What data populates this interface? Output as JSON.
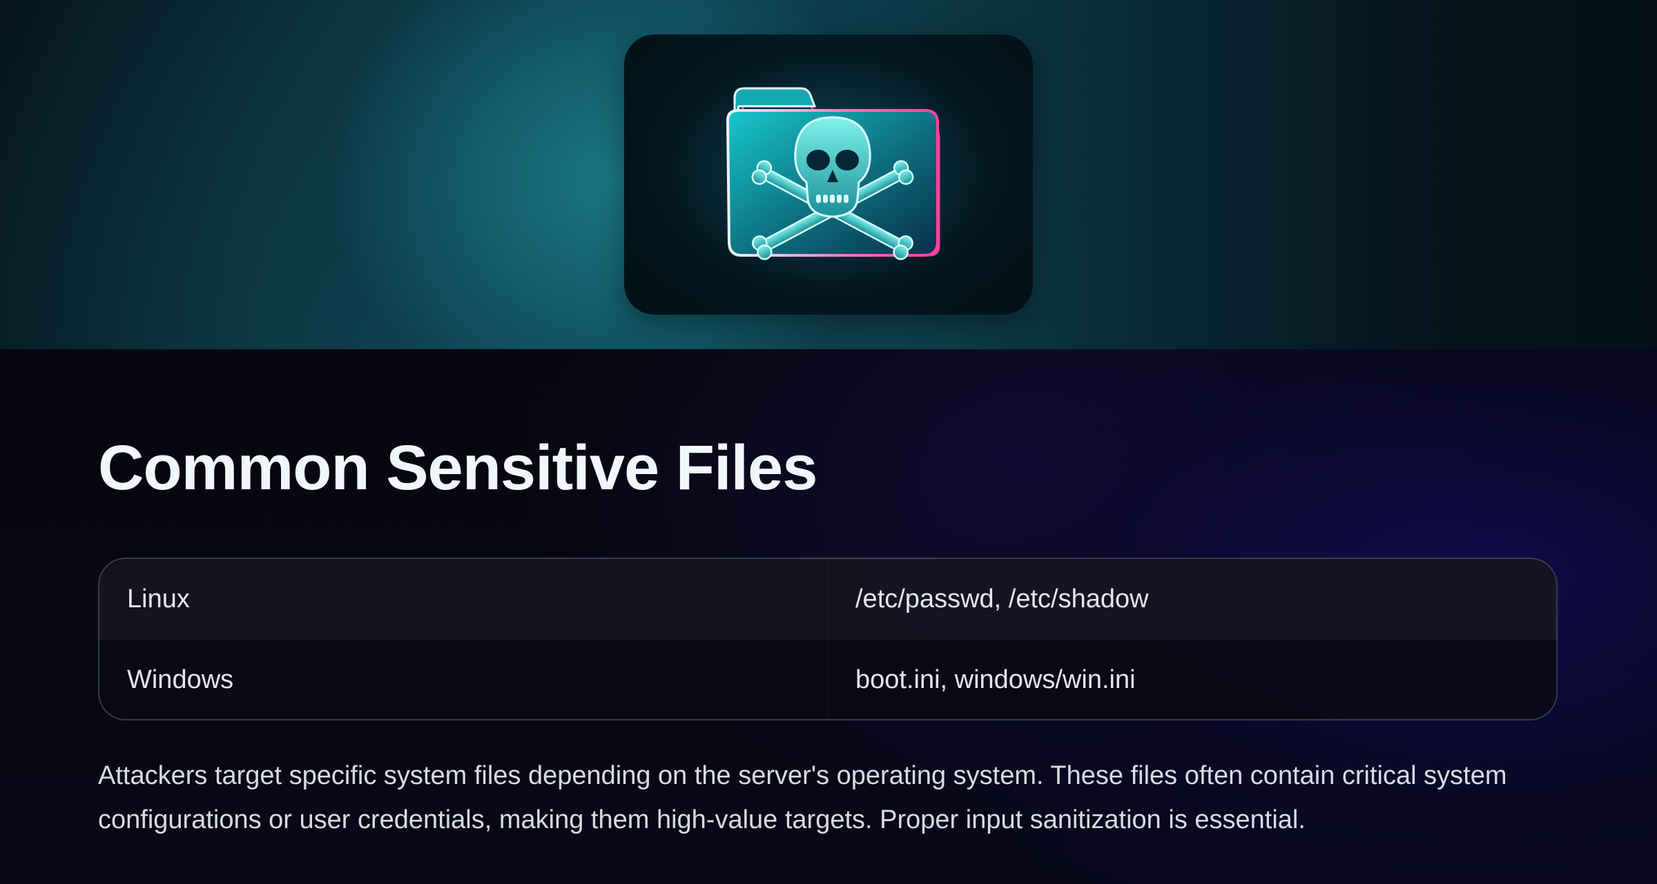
{
  "hero": {
    "icon": "skull-crossbones-folder-icon",
    "colors": {
      "folder_teal": "#1bc4c8",
      "folder_outline_pink": "#ff4fa8",
      "card_background": "#03151d"
    }
  },
  "page": {
    "title": "Common Sensitive Files",
    "table": {
      "rows": [
        {
          "os": "Linux",
          "files": "/etc/passwd, /etc/shadow"
        },
        {
          "os": "Windows",
          "files": "boot.ini, windows/win.ini"
        }
      ]
    },
    "description": "Attackers target specific system files depending on the server's operating system. These files often contain critical system configurations or user credentials, making them high-value targets. Proper input sanitization is essential."
  }
}
